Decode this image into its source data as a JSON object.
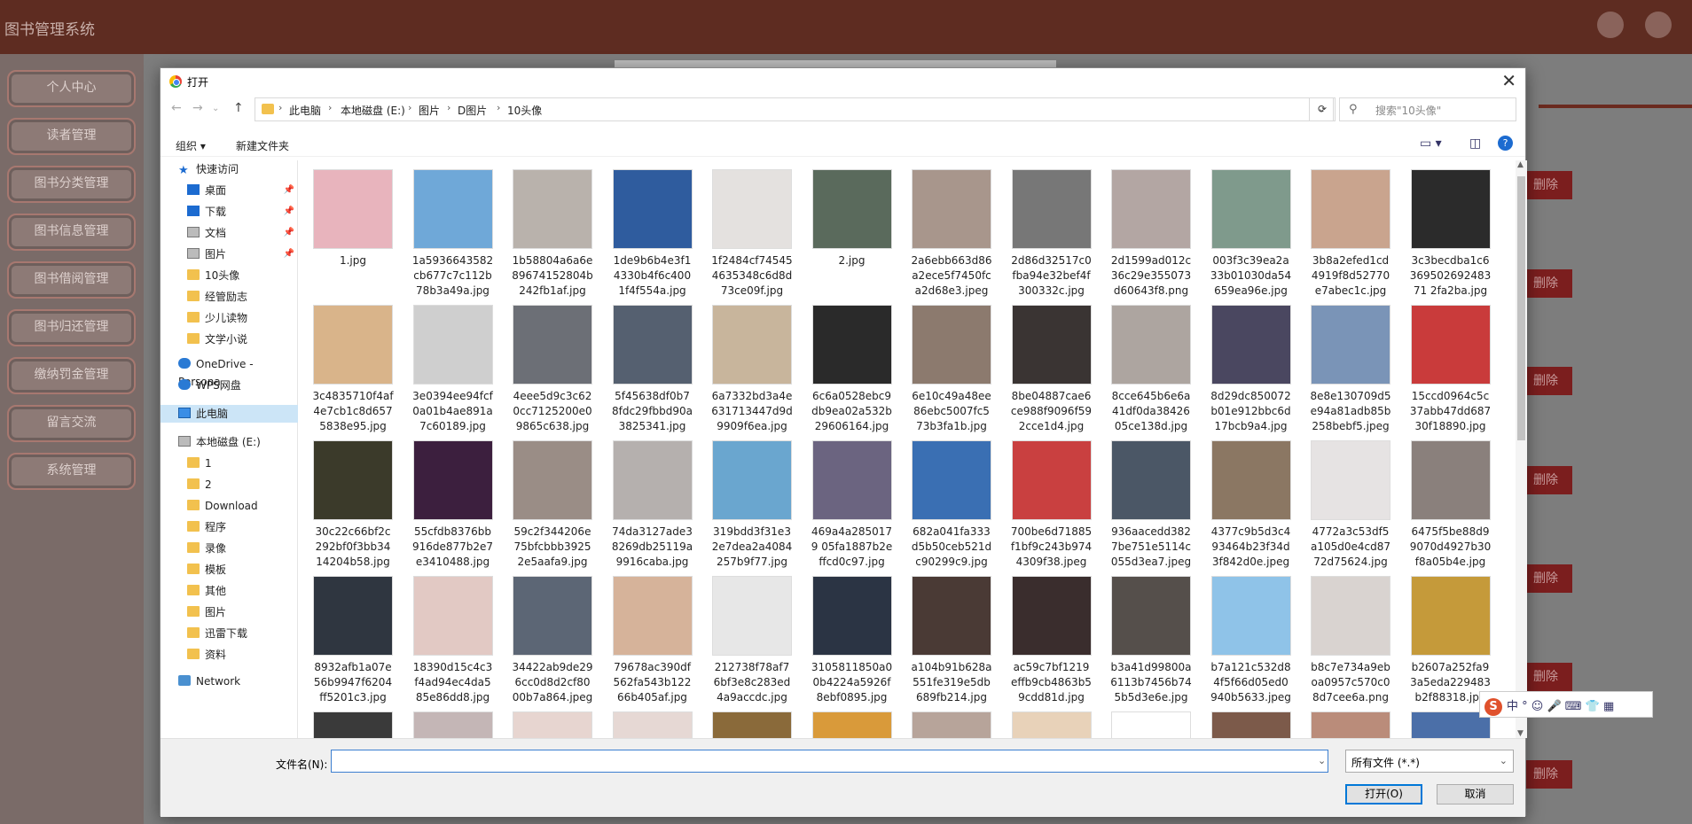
{
  "app": {
    "title": "图书管理系统"
  },
  "sidebar": {
    "items": [
      {
        "label": "个人中心"
      },
      {
        "label": "读者管理"
      },
      {
        "label": "图书分类管理"
      },
      {
        "label": "图书信息管理"
      },
      {
        "label": "图书借阅管理"
      },
      {
        "label": "图书归还管理"
      },
      {
        "label": "缴纳罚金管理"
      },
      {
        "label": "留言交流"
      },
      {
        "label": "系统管理"
      }
    ]
  },
  "background": {
    "delete_label": "删除"
  },
  "dialog": {
    "title": "打开",
    "breadcrumb": [
      "此电脑",
      "本地磁盘 (E:)",
      "图片",
      "D图片",
      "10头像"
    ],
    "search_placeholder": "搜索\"10头像\"",
    "toolbar": {
      "organize": "组织 ▾",
      "new_folder": "新建文件夹"
    },
    "nav": [
      {
        "label": "快速访问",
        "icon": "star-icon"
      },
      {
        "label": "桌面",
        "icon": "desktop-icon",
        "pinned": true
      },
      {
        "label": "下载",
        "icon": "download-icon",
        "pinned": true
      },
      {
        "label": "文档",
        "icon": "document-icon",
        "pinned": true
      },
      {
        "label": "图片",
        "icon": "pictures-icon",
        "pinned": true
      },
      {
        "label": "10头像",
        "icon": "folder-icon"
      },
      {
        "label": "经管励志",
        "icon": "folder-icon"
      },
      {
        "label": "少儿读物",
        "icon": "folder-icon"
      },
      {
        "label": "文学小说",
        "icon": "folder-icon"
      },
      {
        "label": "OneDrive - Persona",
        "icon": "cloud-icon"
      },
      {
        "label": "WPS网盘",
        "icon": "cloud-icon"
      },
      {
        "label": "此电脑",
        "icon": "computer-icon",
        "selected": true
      },
      {
        "label": "本地磁盘 (E:)",
        "icon": "drive-icon"
      },
      {
        "label": "1",
        "icon": "folder-icon"
      },
      {
        "label": "2",
        "icon": "folder-icon"
      },
      {
        "label": "Download",
        "icon": "folder-icon"
      },
      {
        "label": "程序",
        "icon": "folder-icon"
      },
      {
        "label": "录像",
        "icon": "folder-icon"
      },
      {
        "label": "模板",
        "icon": "folder-icon"
      },
      {
        "label": "其他",
        "icon": "folder-icon"
      },
      {
        "label": "图片",
        "icon": "folder-icon"
      },
      {
        "label": "迅雷下载",
        "icon": "folder-icon"
      },
      {
        "label": "资料",
        "icon": "folder-icon"
      },
      {
        "label": "Network",
        "icon": "network-icon"
      }
    ],
    "files": [
      {
        "name": "1.jpg",
        "color": "#e8b4bd"
      },
      {
        "name": "1a5936643582cb677c7c112b78b3a49a.jpg",
        "color": "#6fa8d8"
      },
      {
        "name": "1b58804a6a6e89674152804b242fb1af.jpg",
        "color": "#b9b2ac"
      },
      {
        "name": "1de9b6b4e3f14330b4f6c4001f4f554a.jpg",
        "color": "#2f5c9e"
      },
      {
        "name": "1f2484cf745454635348c6d8d73ce09f.jpg",
        "color": "#e4e1df"
      },
      {
        "name": "2.jpg",
        "color": "#5a6a5c"
      },
      {
        "name": "2a6ebb663d86a2ece5f7450fca2d68e3.jpeg",
        "color": "#a8968c"
      },
      {
        "name": "2d86d32517c0fba94e32bef4f300332c.jpg",
        "color": "#777777"
      },
      {
        "name": "2d1599ad012c36c29e355073d60643f8.png",
        "color": "#b3a6a3"
      },
      {
        "name": "003f3c39ea2a33b01030da54659ea96e.jpg",
        "color": "#7f9a8c"
      },
      {
        "name": "3b8a2efed1cd4919f8d52770e7abec1c.jpg",
        "color": "#c9a48e"
      },
      {
        "name": "3c3becdba1c636950269248371 2fa2ba.jpg",
        "color": "#2b2b2b"
      },
      {
        "name": "3c4835710f4af4e7cb1c8d6575838e95.jpg",
        "color": "#d9b48a"
      },
      {
        "name": "3e0394ee94fcf0a01b4ae891a7c60189.jpg",
        "color": "#cfcfcf"
      },
      {
        "name": "4eee5d9c3c620cc7125200e09865c638.jpg",
        "color": "#6c6f76"
      },
      {
        "name": "5f45638df0b78fdc29fbbd90a3825341.jpg",
        "color": "#556070"
      },
      {
        "name": "6a7332bd3a4e631713447d9d9909f6ea.jpg",
        "color": "#c8b59c"
      },
      {
        "name": "6c6a0528ebc9db9ea02a532b29606164.jpg",
        "color": "#2a2a2a"
      },
      {
        "name": "6e10c49a48ee86ebc5007fc573b3fa1b.jpg",
        "color": "#8c7a6e"
      },
      {
        "name": "8be04887cae6ce988f9096f592cce1d4.jpg",
        "color": "#3a3433"
      },
      {
        "name": "8cce645b6e6a41df0da3842605ce138d.jpg",
        "color": "#ada5a0"
      },
      {
        "name": "8d29dc850072b01e912bbc6d17bcb9a4.jpg",
        "color": "#4a4760"
      },
      {
        "name": "8e8e130709d5e94a81adb85b258bebf5.jpeg",
        "color": "#7a94b7"
      },
      {
        "name": "15ccd0964c5c37abb47dd68730f18890.jpg",
        "color": "#c93b3b"
      },
      {
        "name": "30c22c66bf2c292bf0f3bb3414204b58.jpg",
        "color": "#3b3a2a"
      },
      {
        "name": "55cfdb8376bb916de877b2e7e3410488.jpg",
        "color": "#3c1f3e"
      },
      {
        "name": "59c2f344206e75bfcbbb39252e5aafa9.jpg",
        "color": "#9a8d86"
      },
      {
        "name": "74da3127ade38269db25119a9916caba.jpg",
        "color": "#b5b0ae"
      },
      {
        "name": "319bdd3f31e32e7dea2a4084257b9f77.jpg",
        "color": "#6aa6cf"
      },
      {
        "name": "469a4a2850179 05fa1887b2effcd0c97.jpg",
        "color": "#6b6480"
      },
      {
        "name": "682a041fa333d5b50ceb521dc90299c9.jpg",
        "color": "#3a6fb3"
      },
      {
        "name": "700be6d71885f1bf9c243b9744309f38.jpeg",
        "color": "#c94040"
      },
      {
        "name": "936aacedd3827be751e5114c055d3ea7.jpeg",
        "color": "#4b5766"
      },
      {
        "name": "4377c9b5d3c493464b23f34d3f842d0e.jpeg",
        "color": "#8b7763"
      },
      {
        "name": "4772a3c53df5a105d0e4cd8772d75624.jpg",
        "color": "#e6e3e3"
      },
      {
        "name": "6475f5be88d99070d4927b30f8a05b4e.jpg",
        "color": "#8a807c"
      },
      {
        "name": "8932afb1a07e56b9947f6204ff5201c3.jpg",
        "color": "#2f3640"
      },
      {
        "name": "18390d15c4c3f4ad94ec4da585e86dd8.jpg",
        "color": "#e2c9c4"
      },
      {
        "name": "34422ab9de296cc0d8d2cf8000b7a864.jpeg",
        "color": "#5c6675"
      },
      {
        "name": "79678ac390df562fa543b12266b405af.jpg",
        "color": "#d6b39a"
      },
      {
        "name": "212738f78af76bf3e8c283ed4a9accdc.jpg",
        "color": "#e7e7e7"
      },
      {
        "name": "3105811850a00b4224a5926f8ebf0895.jpg",
        "color": "#2b3444"
      },
      {
        "name": "a104b91b628a551fe319e5db689fb214.jpg",
        "color": "#4a3a35"
      },
      {
        "name": "ac59c7bf1219effb9cb4863b59cdd81d.jpg",
        "color": "#3a2d2d"
      },
      {
        "name": "b3a41d99800a6113b7456b745b5d3e6e.jpg",
        "color": "#554f4b"
      },
      {
        "name": "b7a121c532d84f5f66d05ed0940b5633.jpeg",
        "color": "#8fc3e8"
      },
      {
        "name": "b8c7e734a9eboa0957c570c08d7cee6a.png",
        "color": "#d9d3d0"
      },
      {
        "name": "b2607a252fa93a5eda229483b2f88318.jpg",
        "color": "#c59a3a"
      }
    ],
    "partial_row_colors": [
      "#3a3a3a",
      "#c4b6b6",
      "#e7d5d0",
      "#e6d8d4",
      "#8a6a3a",
      "#d99a3a",
      "#b7a49a",
      "#e8d2b9",
      "#ffffff",
      "#7c5a4a",
      "#ba8c7a",
      "#4b6fa8",
      "#3b5b8a"
    ],
    "filename_label": "文件名(N):",
    "filename_value": "",
    "filetype": "所有文件 (*.*)",
    "open_label": "打开(O)",
    "cancel_label": "取消"
  },
  "ime": {
    "items": "中 ° ☺ 🎤 ⌨ 👕 ▦"
  }
}
